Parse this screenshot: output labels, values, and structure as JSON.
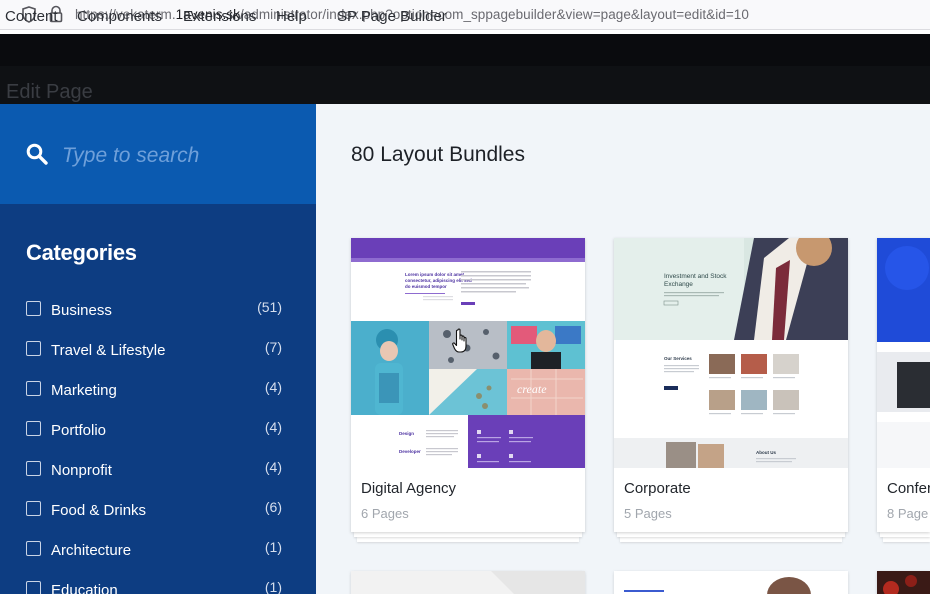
{
  "browser": {
    "url_prefix": "https://vekaterm.",
    "url_host": "1avenis.sk",
    "url_path": "/administrator/index.php?option=com_sppagebuilder&view=page&layout=edit&id=10"
  },
  "admin_menu": [
    "Content",
    "Components",
    "Extensions",
    "Help",
    "SP Page Builder"
  ],
  "page_title": "Edit Page",
  "search": {
    "placeholder": "Type to search"
  },
  "categories": {
    "title": "Categories",
    "items": [
      {
        "label": "Business",
        "count": "(51)"
      },
      {
        "label": "Travel & Lifestyle",
        "count": "(7)"
      },
      {
        "label": "Marketing",
        "count": "(4)"
      },
      {
        "label": "Portfolio",
        "count": "(4)"
      },
      {
        "label": "Nonprofit",
        "count": "(4)"
      },
      {
        "label": "Food & Drinks",
        "count": "(6)"
      },
      {
        "label": "Architecture",
        "count": "(1)"
      },
      {
        "label": "Education",
        "count": "(1)"
      }
    ]
  },
  "main": {
    "heading": "80 Layout Bundles",
    "bundles": [
      {
        "title": "Digital Agency",
        "pages": "6 Pages"
      },
      {
        "title": "Corporate",
        "pages": "5 Pages"
      },
      {
        "title": "Confer",
        "pages": "8 Page"
      }
    ]
  },
  "thumbnails": {
    "digital_agency": {
      "hero_text": "Lorem ipsum dolor sit amet consectetur, adipiscing elit sed do euismod tempor",
      "design_label": "Design",
      "developer_label": "Developer",
      "create_text": "create"
    },
    "corporate": {
      "hero_title": "Investment and Stock Exchange",
      "services_title": "Our Services",
      "about_title": "About Us"
    }
  },
  "colors": {
    "search_panel": "#0b5ab0",
    "categories_panel": "#0d3d82",
    "main_bg": "#f1f5f9",
    "agency_purple": "#6a3fb8"
  }
}
